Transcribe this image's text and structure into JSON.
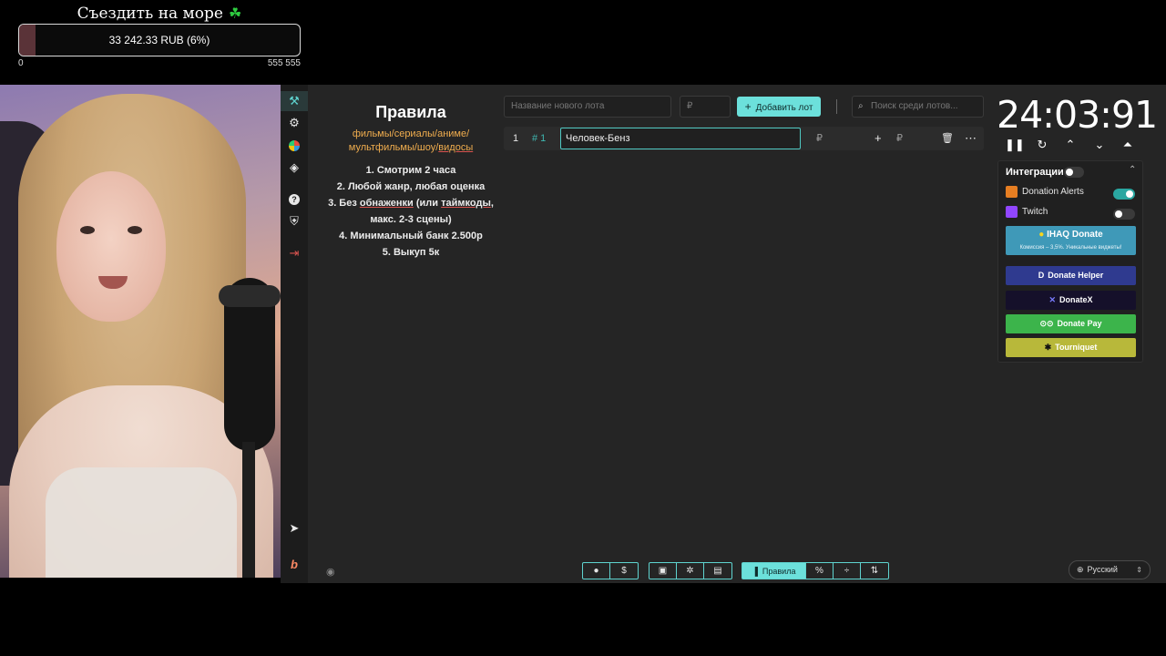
{
  "goal": {
    "title": "Съездить на море",
    "icon": "clover-icon",
    "amount_text": "33 242.33 RUB (6%)",
    "progress": 0.06,
    "scale_min": "0",
    "scale_max": "555 555"
  },
  "sidebar": {
    "items": [
      {
        "name": "auction-icon",
        "glyph": "⚒"
      },
      {
        "name": "settings-icon",
        "glyph": "⚙"
      },
      {
        "name": "wheel-icon",
        "glyph": ""
      },
      {
        "name": "layers-icon",
        "glyph": "◈"
      },
      {
        "name": "help-icon",
        "glyph": "?"
      },
      {
        "name": "shield-icon",
        "glyph": "⛨"
      },
      {
        "name": "logout-icon",
        "glyph": "⇥"
      },
      {
        "name": "telegram-icon",
        "glyph": "➤"
      },
      {
        "name": "boosty-icon",
        "glyph": "b"
      }
    ]
  },
  "rules": {
    "title": "Правила",
    "categories_prefix": "фильмы/сериалы/аниме/мультфильмы/шоу/",
    "categories_underlined": "видосы",
    "items": [
      "1. Смотрим 2 часа",
      "2. Любой жанр, любая оценка",
      "3. Без ",
      "обнаженки",
      " (или ",
      "таймкоды",
      ",",
      "макс. 2-3 сцены)",
      "4. Минимальный банк 2.500р",
      "5. Выкуп 5к"
    ]
  },
  "lot_form": {
    "name_placeholder": "Название нового лота",
    "amount_placeholder": "₽",
    "add_label": "Добавить лот",
    "search_placeholder": "Поиск среди лотов..."
  },
  "lots": [
    {
      "index": "1",
      "id": "# 1",
      "name": "Человек-Бенз",
      "currency": "₽"
    }
  ],
  "timer": {
    "value": "24:03:91"
  },
  "integrations": {
    "title": "Интеграции",
    "services": [
      {
        "label": "Donation Alerts",
        "color": "#e67e22",
        "enabled": true
      },
      {
        "label": "Twitch",
        "color": "#9146ff",
        "enabled": false
      }
    ],
    "ihaq_title": "IHAQ Donate",
    "ihaq_subtitle": "Комиссия – 3,5%. Уникальные виджеты!",
    "buttons": [
      {
        "label": "Donate Helper",
        "color": "#2f3a8f"
      },
      {
        "label": "DonateX",
        "color": "#15102a"
      },
      {
        "label": "Donate Pay",
        "color": "#3cb44b"
      },
      {
        "label": "Tourniquet",
        "color": "#b8b83a"
      }
    ]
  },
  "toolbar": {
    "rules_label": "Правила",
    "percent_label": "%"
  },
  "language": {
    "value": "Русский"
  }
}
